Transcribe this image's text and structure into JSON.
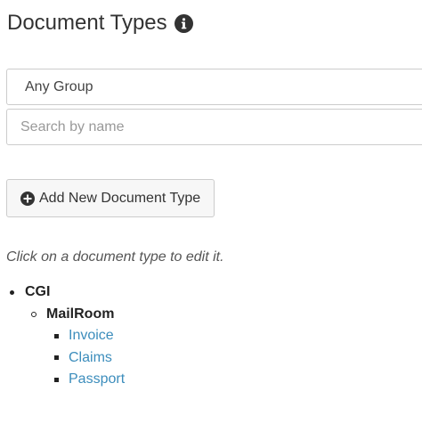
{
  "header": {
    "title": "Document Types",
    "info_icon": "info-circle-icon"
  },
  "filters": {
    "group_select_value": "Any Group",
    "search_placeholder": "Search by name",
    "search_value": ""
  },
  "actions": {
    "add_button_label": "Add New Document Type",
    "add_button_icon": "plus-circle-icon"
  },
  "hint": "Click on a document type to edit it.",
  "tree": {
    "group": "CGI",
    "subgroup": "MailRoom",
    "document_types": [
      "Invoice",
      "Claims",
      "Passport"
    ]
  },
  "colors": {
    "link": "#3c8dbc",
    "text": "#333333",
    "border": "#cccccc"
  }
}
